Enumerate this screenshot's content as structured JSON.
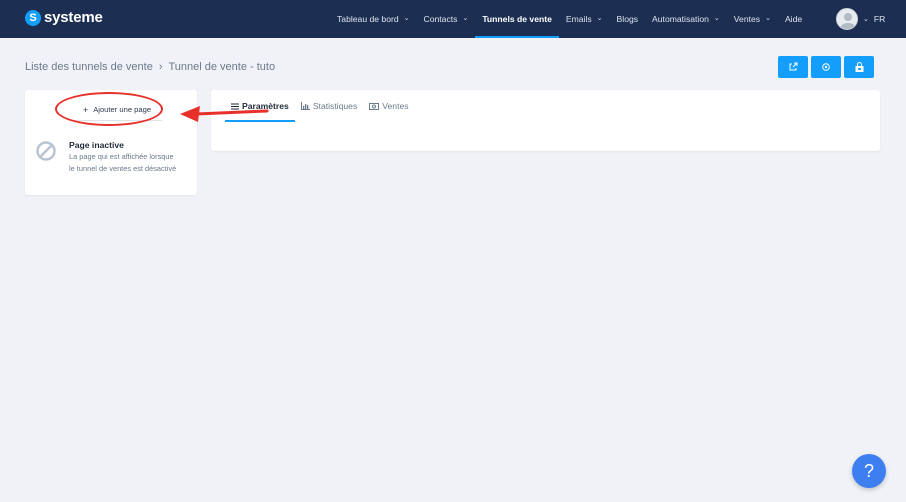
{
  "brand": {
    "name": "systeme",
    "accent": "#149efc",
    "nav_bg": "#1c2f52"
  },
  "nav": {
    "items": [
      {
        "label": "Tableau de bord",
        "dropdown": true
      },
      {
        "label": "Contacts",
        "dropdown": true
      },
      {
        "label": "Tunnels de vente",
        "dropdown": false,
        "active": true
      },
      {
        "label": "Emails",
        "dropdown": true
      },
      {
        "label": "Blogs",
        "dropdown": false
      },
      {
        "label": "Automatisation",
        "dropdown": true
      },
      {
        "label": "Ventes",
        "dropdown": true
      },
      {
        "label": "Aide",
        "dropdown": false
      }
    ],
    "chevron": "⌄",
    "language": "FR"
  },
  "breadcrumb": {
    "parent": "Liste des tunnels de vente",
    "separator": "›",
    "current": "Tunnel de vente - tuto"
  },
  "actions": [
    {
      "icon": "external-link-icon"
    },
    {
      "icon": "settings-icon"
    },
    {
      "icon": "shop-icon"
    }
  ],
  "left_panel": {
    "add_page_plus": "+",
    "add_page_label": "Ajouter une page",
    "inactive_page": {
      "title": "Page inactive",
      "description": "La page qui est affichée lorsque le tunnel de ventes est désactivé"
    }
  },
  "tabs": [
    {
      "label": "Paramètres",
      "icon": "list-icon",
      "active": true
    },
    {
      "label": "Statistiques",
      "icon": "bar-chart-icon",
      "active": false
    },
    {
      "label": "Ventes",
      "icon": "money-icon",
      "active": false
    }
  ],
  "help": {
    "label": "?"
  },
  "annotation_color": "#e8302a"
}
